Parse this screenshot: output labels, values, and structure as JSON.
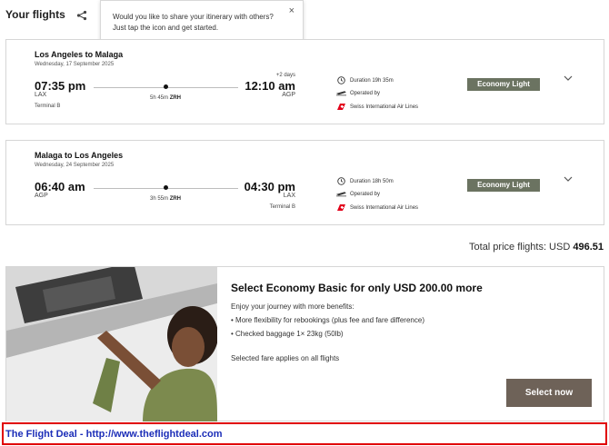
{
  "header": {
    "title": "Your flights",
    "share_icon": "share-icon"
  },
  "tooltip": {
    "text": "Would you like to share your itinerary with others? Just tap the icon and get started.",
    "close_label": "×"
  },
  "flights": [
    {
      "route": "Los Angeles to Malaga",
      "date": "Wednesday, 17 September 2025",
      "departure_time": "07:35 pm",
      "departure_code": "LAX",
      "departure_terminal": "Terminal B",
      "arrival_time": "12:10 am",
      "arrival_code": "AGP",
      "arrival_terminal": "",
      "plus_days": "+2 days",
      "layover_duration": "5h 45m",
      "layover_airport": "ZRH",
      "duration": "Duration  19h 35m",
      "operated_by": "Operated by",
      "airline": "Swiss International Air Lines",
      "fare": "Economy Light"
    },
    {
      "route": "Malaga to Los Angeles",
      "date": "Wednesday, 24 September 2025",
      "departure_time": "06:40 am",
      "departure_code": "AGP",
      "departure_terminal": "",
      "arrival_time": "04:30 pm",
      "arrival_code": "LAX",
      "arrival_terminal": "Terminal B",
      "plus_days": "",
      "layover_duration": "3h 55m",
      "layover_airport": "ZRH",
      "duration": "Duration  18h 50m",
      "operated_by": "Operated by",
      "airline": "Swiss International Air Lines",
      "fare": "Economy Light"
    }
  ],
  "total": {
    "label": "Total price flights: USD",
    "amount": "496.51"
  },
  "upsell": {
    "title": "Select Economy Basic for only USD 200.00 more",
    "intro": "Enjoy your journey with more benefits:",
    "benefits": [
      "• More flexibility for rebookings (plus fee and fare difference)",
      "• Checked baggage 1× 23kg (50lb)"
    ],
    "note": "Selected fare applies on all flights",
    "button_label": "Select now"
  },
  "footer": {
    "text": "The Flight Deal - http://www.theflightdeal.com"
  },
  "colors": {
    "fare_badge": "#6b7361",
    "select_button": "#6e6258",
    "footer_border": "#e00000",
    "footer_text": "#1c2eb8",
    "airline_red": "#e2001a"
  }
}
